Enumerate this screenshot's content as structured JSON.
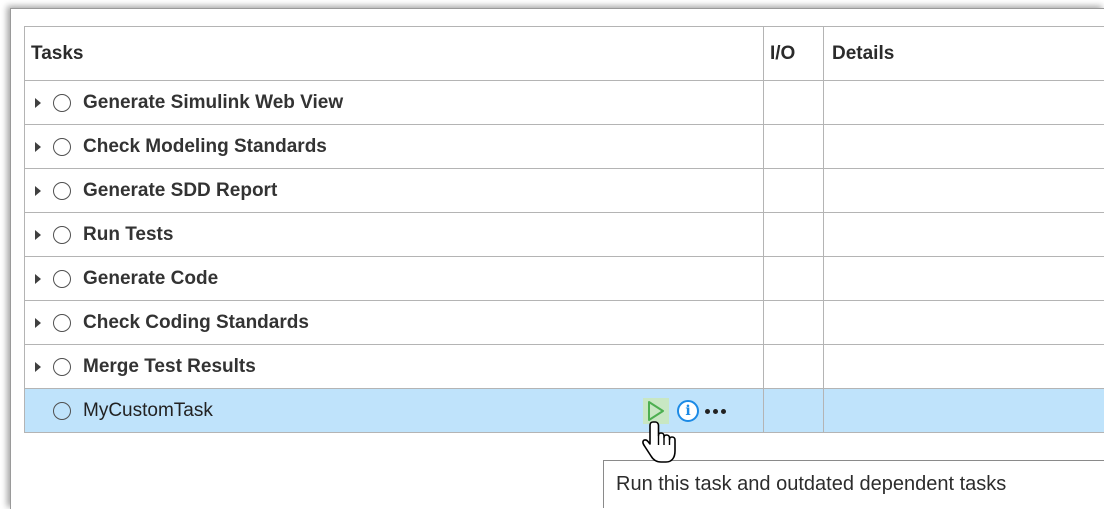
{
  "table": {
    "headers": {
      "tasks": "Tasks",
      "io": "I/O",
      "details": "Details"
    },
    "rows": [
      {
        "label": "Generate Simulink Web View",
        "expandable": true
      },
      {
        "label": "Check Modeling Standards",
        "expandable": true
      },
      {
        "label": "Generate SDD Report",
        "expandable": true
      },
      {
        "label": "Run Tests",
        "expandable": true
      },
      {
        "label": "Generate Code",
        "expandable": true
      },
      {
        "label": "Check Coding Standards",
        "expandable": true
      },
      {
        "label": "Merge Test Results",
        "expandable": true
      },
      {
        "label": "MyCustomTask",
        "expandable": false,
        "selected": true
      }
    ]
  },
  "row_actions": {
    "run_icon": "play-icon",
    "info_icon": "info-icon",
    "info_glyph": "i",
    "more_icon": "more-icon"
  },
  "tooltip": {
    "text": "Run this task and outdated dependent tasks"
  },
  "colors": {
    "selected_row": "#bfe3fb",
    "run_button_bg": "#c8e7c3",
    "run_icon": "#4caf50",
    "info_icon": "#1c8ae5"
  }
}
